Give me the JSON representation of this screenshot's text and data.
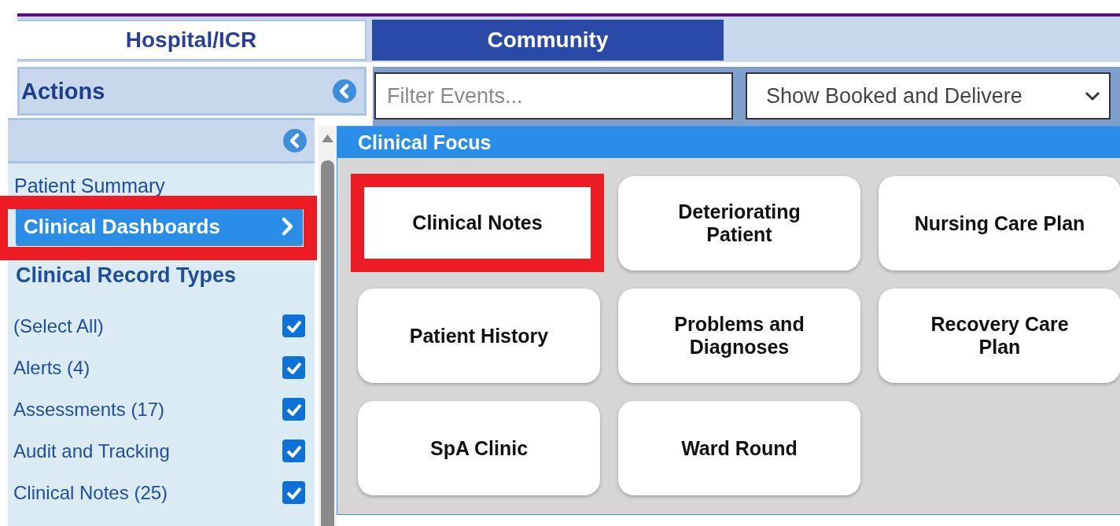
{
  "tabs": [
    {
      "label": "Hospital/ICR",
      "selected": true
    },
    {
      "label": "Community",
      "selected": false
    }
  ],
  "actions_panel": {
    "title": "Actions"
  },
  "filter": {
    "placeholder": "Filter Events..."
  },
  "event_select": {
    "value": "Show Booked and Delivere"
  },
  "sidebar": {
    "items": [
      {
        "label": "Patient Summary",
        "selected": false,
        "highlighted": false
      },
      {
        "label": "Clinical Dashboards",
        "selected": true,
        "highlighted": true
      }
    ],
    "section_title": "Clinical Record Types",
    "options": [
      {
        "label": "(Select All)",
        "checked": true
      },
      {
        "label": "Alerts (4)",
        "checked": true
      },
      {
        "label": "Assessments (17)",
        "checked": true
      },
      {
        "label": "Audit and Tracking",
        "checked": true
      },
      {
        "label": "Clinical Notes (25)",
        "checked": true
      }
    ]
  },
  "popup": {
    "title": "Clinical Focus",
    "tiles": [
      {
        "label": "Clinical Notes",
        "highlighted": true
      },
      {
        "label": "Deteriorating Patient",
        "highlighted": false
      },
      {
        "label": "Nursing Care Plan",
        "highlighted": false
      },
      {
        "label": "Patient History",
        "highlighted": false
      },
      {
        "label": "Problems and Diagnoses",
        "highlighted": false
      },
      {
        "label": "Recovery Care Plan",
        "highlighted": false
      },
      {
        "label": "SpA Clinic",
        "highlighted": false
      },
      {
        "label": "Ward Round",
        "highlighted": false
      }
    ]
  }
}
